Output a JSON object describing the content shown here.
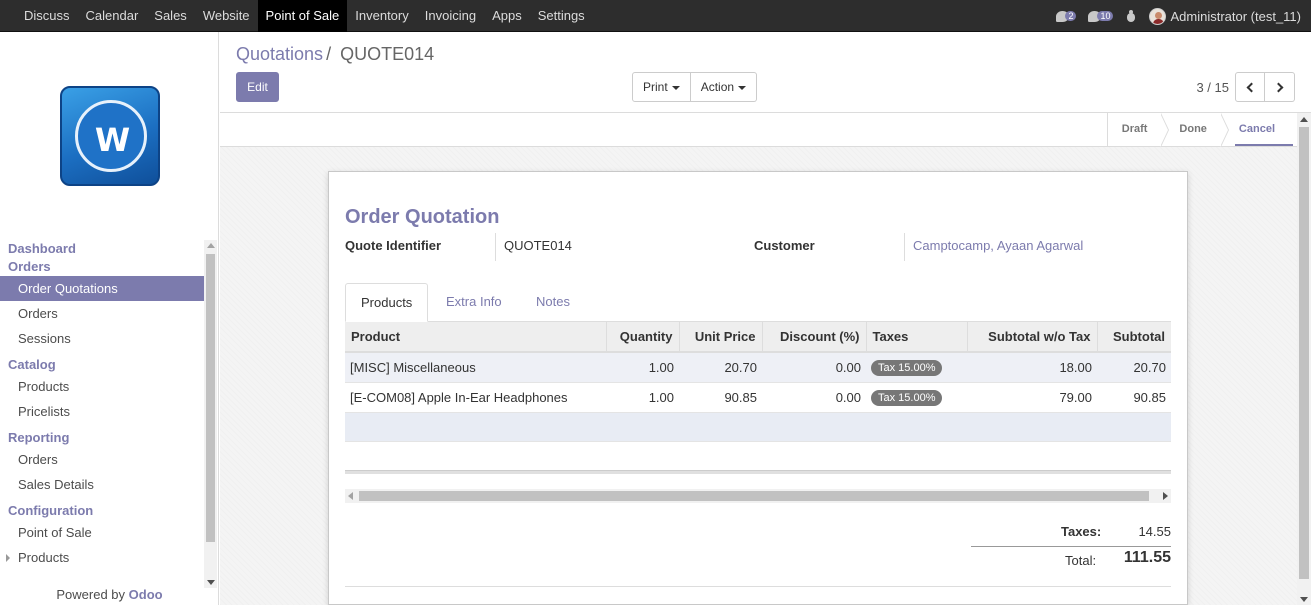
{
  "topbar": {
    "menu": [
      "Discuss",
      "Calendar",
      "Sales",
      "Website",
      "Point of Sale",
      "Inventory",
      "Invoicing",
      "Apps",
      "Settings"
    ],
    "active": "Point of Sale",
    "conversations_count": "2",
    "messages_count": "10",
    "user": "Administrator (test_11)"
  },
  "sidebar": {
    "sections": [
      {
        "title": "Dashboard"
      },
      {
        "title": "Orders",
        "items": [
          "Order Quotations",
          "Orders",
          "Sessions"
        ]
      },
      {
        "title": "Catalog",
        "items": [
          "Products",
          "Pricelists"
        ]
      },
      {
        "title": "Reporting",
        "items": [
          "Orders",
          "Sales Details"
        ]
      },
      {
        "title": "Configuration",
        "items": [
          "Point of Sale",
          "Products"
        ]
      }
    ],
    "active_item": "Order Quotations",
    "powered_prefix": "Powered by",
    "powered_brand": "Odoo"
  },
  "control_panel": {
    "breadcrumb_parent": "Quotations",
    "breadcrumb_sep": "/",
    "breadcrumb_current": "QUOTE014",
    "edit_label": "Edit",
    "print_label": "Print",
    "action_label": "Action",
    "pager": "3 / 15"
  },
  "statusbar": {
    "stages": [
      "Draft",
      "Done",
      "Cancel"
    ],
    "current": "Cancel"
  },
  "form": {
    "title": "Order Quotation",
    "quote_identifier_label": "Quote Identifier",
    "quote_identifier_value": "QUOTE014",
    "customer_label": "Customer",
    "customer_value": "Camptocamp, Ayaan Agarwal",
    "tabs": [
      "Products",
      "Extra Info",
      "Notes"
    ],
    "active_tab": "Products",
    "columns": [
      "Product",
      "Quantity",
      "Unit Price",
      "Discount (%)",
      "Taxes",
      "Subtotal w/o Tax",
      "Subtotal"
    ],
    "lines": [
      {
        "product": "[MISC] Miscellaneous",
        "quantity": "1.00",
        "unit_price": "20.70",
        "discount": "0.00",
        "taxes": "Tax 15.00%",
        "subtotal_wo_tax": "18.00",
        "subtotal": "20.70"
      },
      {
        "product": "[E-COM08] Apple In-Ear Headphones",
        "quantity": "1.00",
        "unit_price": "90.85",
        "discount": "0.00",
        "taxes": "Tax 15.00%",
        "subtotal_wo_tax": "79.00",
        "subtotal": "90.85"
      }
    ],
    "taxes_label": "Taxes:",
    "taxes_value": "14.55",
    "total_label": "Total:",
    "total_value": "111.55"
  },
  "colors": {
    "accent": "#7c7bad",
    "navbar": "#2d2d2d"
  }
}
